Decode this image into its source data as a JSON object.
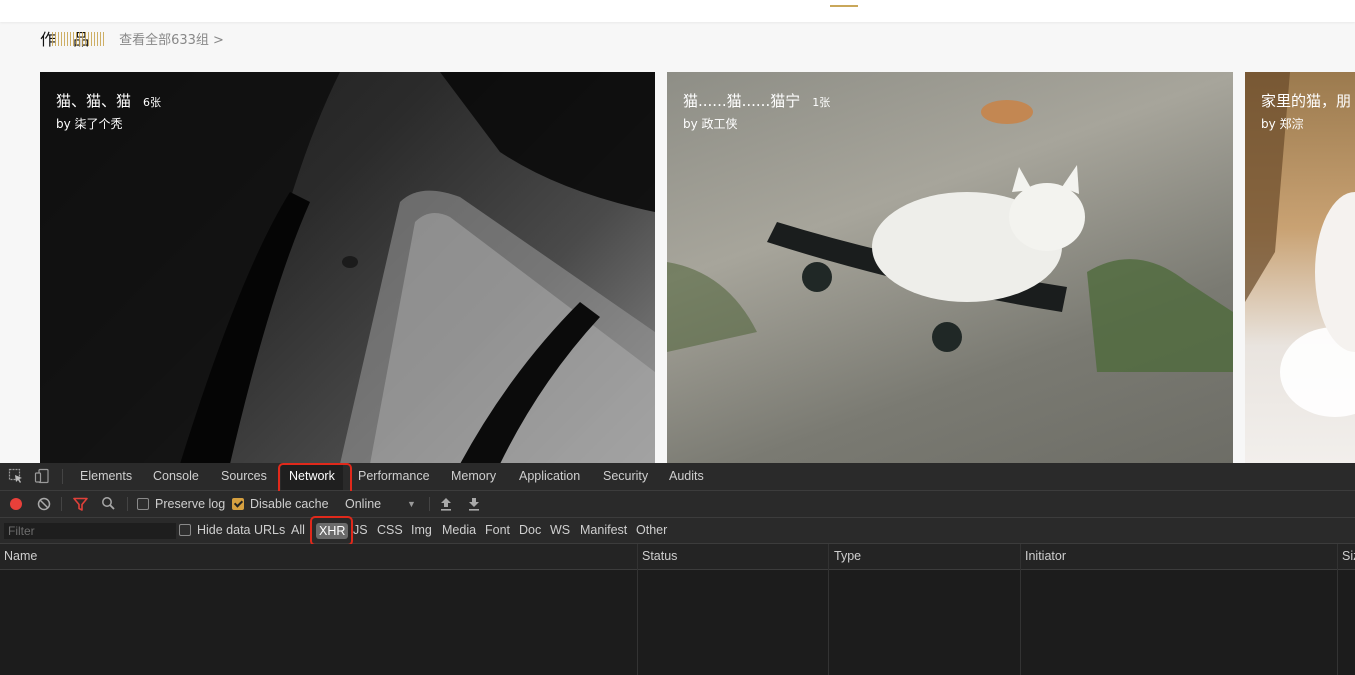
{
  "site": {
    "section_title": "作 品",
    "view_all": "查看全部633组 >",
    "cards": [
      {
        "title": "猫、猫、猫",
        "count": "6张",
        "author": "by 柒了个秃"
      },
      {
        "title": "猫......猫......猫宁",
        "count": "1张",
        "author": "by 政工侠"
      },
      {
        "title": "家里的猫，朋",
        "count": "",
        "author": "by 郑淙"
      }
    ]
  },
  "devtools": {
    "tabs": [
      "Elements",
      "Console",
      "Sources",
      "Network",
      "Performance",
      "Memory",
      "Application",
      "Security",
      "Audits"
    ],
    "active_tab": "Network",
    "toolbar": {
      "preserve_log": "Preserve log",
      "preserve_log_checked": false,
      "disable_cache": "Disable cache",
      "disable_cache_checked": true,
      "throttling": "Online"
    },
    "filter": {
      "placeholder": "Filter",
      "hide_data_urls": "Hide data URLs",
      "hide_data_urls_checked": false,
      "types": [
        "All",
        "XHR",
        "JS",
        "CSS",
        "Img",
        "Media",
        "Font",
        "Doc",
        "WS",
        "Manifest",
        "Other"
      ],
      "active_type": "XHR"
    },
    "columns": [
      "Name",
      "Status",
      "Type",
      "Initiator",
      "Size"
    ],
    "rows": []
  },
  "colors": {
    "highlight": "#e0291b",
    "record": "#e8403a",
    "filter_icon": "#e0413a",
    "accent": "#c9a75a"
  }
}
